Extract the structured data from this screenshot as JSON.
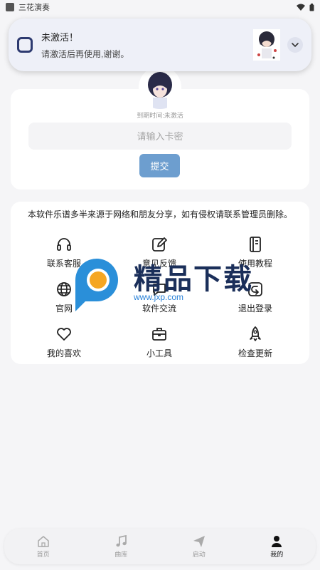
{
  "status_bar": {
    "app_name": "三花演奏"
  },
  "notification": {
    "title": "未激活！",
    "body": "请激活后再使用,谢谢。"
  },
  "profile": {
    "expire_text": "到期时间:未激活",
    "key_placeholder": "请输入卡密",
    "submit_label": "提交"
  },
  "notice": "本软件乐谱多半来源于网络和朋友分享，如有侵权请联系管理员删除。",
  "menu": [
    {
      "label": "联系客服",
      "icon": "headset-icon"
    },
    {
      "label": "意见反馈",
      "icon": "edit-icon"
    },
    {
      "label": "使用教程",
      "icon": "notebook-icon"
    },
    {
      "label": "官网",
      "icon": "globe-icon"
    },
    {
      "label": "软件交流",
      "icon": "chat-icon"
    },
    {
      "label": "退出登录",
      "icon": "logout-icon"
    },
    {
      "label": "我的喜欢",
      "icon": "heart-icon"
    },
    {
      "label": "小工具",
      "icon": "toolbox-icon"
    },
    {
      "label": "检查更新",
      "icon": "rocket-icon"
    }
  ],
  "watermark": {
    "text": "精品下载",
    "url": "www.jxp.com"
  },
  "nav": [
    {
      "label": "首页",
      "icon": "home-icon",
      "active": false
    },
    {
      "label": "曲库",
      "icon": "music-icon",
      "active": false
    },
    {
      "label": "启动",
      "icon": "send-icon",
      "active": false
    },
    {
      "label": "我的",
      "icon": "user-icon",
      "active": true
    }
  ],
  "colors": {
    "accent": "#6d9ecf",
    "background": "#f5f5f7",
    "card": "#ffffff"
  }
}
